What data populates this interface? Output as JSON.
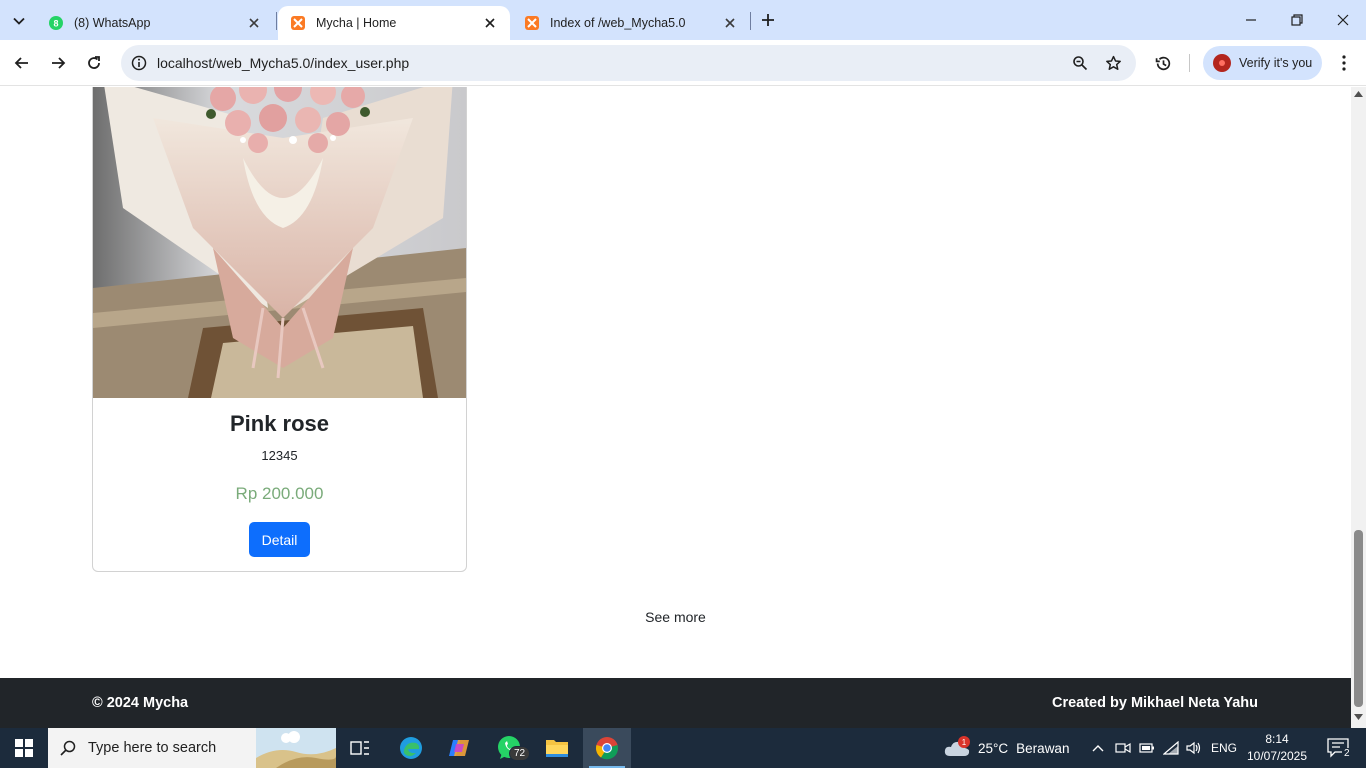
{
  "browser": {
    "tabs": [
      {
        "title": "(8) WhatsApp",
        "icon": "whatsapp-icon",
        "active": false
      },
      {
        "title": "Mycha | Home",
        "icon": "xampp-icon",
        "active": true
      },
      {
        "title": "Index of /web_Mycha5.0",
        "icon": "xampp-icon",
        "active": false
      }
    ],
    "url": "localhost/web_Mycha5.0/index_user.php",
    "verify_label": "Verify it's you"
  },
  "product": {
    "name": "Pink rose",
    "code": "12345",
    "price": "Rp 200.000",
    "detail_label": "Detail",
    "image": "pink-rose-bouquet"
  },
  "see_more_label": "See more",
  "footer": {
    "copyright": "© 2024 Mycha",
    "credit": "Created by Mikhael Neta Yahu"
  },
  "taskbar": {
    "search_placeholder": "Type here to search",
    "whatsapp_badge": "72",
    "weather_temp": "25°C",
    "weather_desc": "Berawan",
    "weather_alert": "1",
    "language": "ENG",
    "time": "8:14",
    "date": "10/07/2025",
    "notification_count": "2"
  },
  "colors": {
    "tabstrip": "#d3e3fd",
    "primary_button": "#0d6efd",
    "price": "#7aab7a",
    "footer": "#212529",
    "taskbar": "#1c2b3c"
  }
}
